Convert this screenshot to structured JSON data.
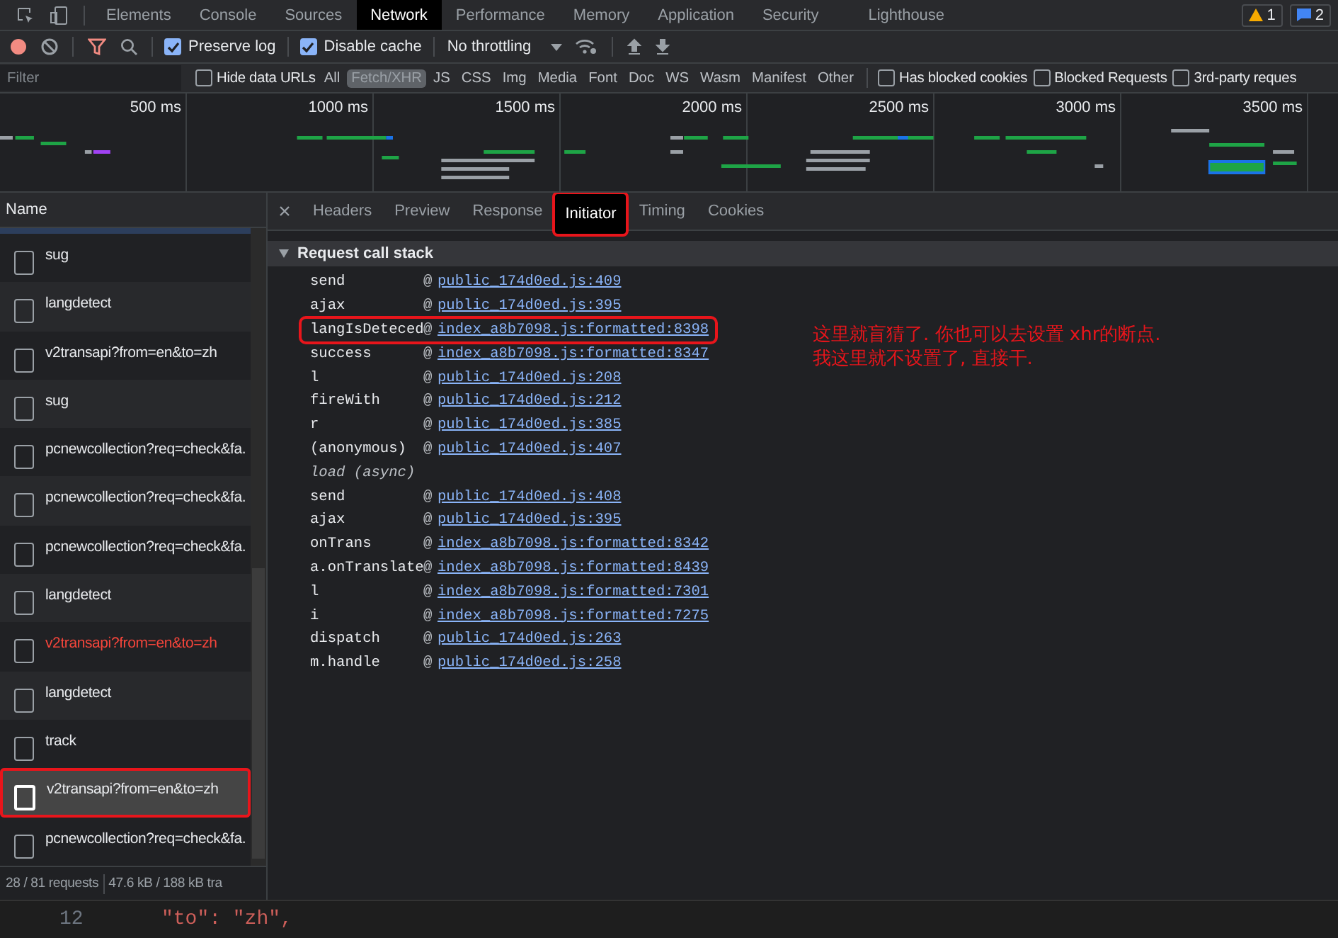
{
  "devtools_tabs": [
    {
      "label": "Elements",
      "selected": false
    },
    {
      "label": "Console",
      "selected": false
    },
    {
      "label": "Sources",
      "selected": false
    },
    {
      "label": "Network",
      "selected": true
    },
    {
      "label": "Performance",
      "selected": false
    },
    {
      "label": "Memory",
      "selected": false
    },
    {
      "label": "Application",
      "selected": false
    },
    {
      "label": "Security",
      "selected": false
    },
    {
      "label": "Lighthouse",
      "selected": false
    }
  ],
  "badges": [
    {
      "kind": "warning",
      "count": "1"
    },
    {
      "kind": "message",
      "count": "2"
    }
  ],
  "toolbar": {
    "recording": true,
    "preserve_log": {
      "label": "Preserve log",
      "checked": true
    },
    "disable_cache": {
      "label": "Disable cache",
      "checked": true
    },
    "throttling": "No throttling"
  },
  "filter": {
    "placeholder": "Filter",
    "hide_data_urls": {
      "label": "Hide data URLs",
      "checked": false
    },
    "types": [
      {
        "label": "All",
        "selected": false
      },
      {
        "label": "Fetch/XHR",
        "selected": true
      },
      {
        "label": "JS",
        "selected": false
      },
      {
        "label": "CSS",
        "selected": false
      },
      {
        "label": "Img",
        "selected": false
      },
      {
        "label": "Media",
        "selected": false
      },
      {
        "label": "Font",
        "selected": false
      },
      {
        "label": "Doc",
        "selected": false
      },
      {
        "label": "WS",
        "selected": false
      },
      {
        "label": "Wasm",
        "selected": false
      },
      {
        "label": "Manifest",
        "selected": false
      },
      {
        "label": "Other",
        "selected": false
      }
    ],
    "options": [
      {
        "label": "Has blocked cookies",
        "checked": false
      },
      {
        "label": "Blocked Requests",
        "checked": false
      },
      {
        "label": "3rd-party reques",
        "checked": false
      }
    ]
  },
  "overview": {
    "ticks": [
      "500 ms",
      "1000 ms",
      "1500 ms",
      "2000 ms",
      "2500 ms",
      "3000 ms",
      "3500 ms"
    ]
  },
  "requests": {
    "column": "Name",
    "rows": [
      {
        "name": "sug",
        "failed": false,
        "selected": false,
        "highlighted": false
      },
      {
        "name": "langdetect",
        "failed": false,
        "selected": false,
        "highlighted": false
      },
      {
        "name": "v2transapi?from=en&to=zh",
        "failed": false,
        "selected": false,
        "highlighted": false
      },
      {
        "name": "sug",
        "failed": false,
        "selected": false,
        "highlighted": false
      },
      {
        "name": "pcnewcollection?req=check&fa.",
        "failed": false,
        "selected": false,
        "highlighted": false
      },
      {
        "name": "pcnewcollection?req=check&fa.",
        "failed": false,
        "selected": false,
        "highlighted": false
      },
      {
        "name": "pcnewcollection?req=check&fa.",
        "failed": false,
        "selected": false,
        "highlighted": false
      },
      {
        "name": "langdetect",
        "failed": false,
        "selected": false,
        "highlighted": false
      },
      {
        "name": "v2transapi?from=en&to=zh",
        "failed": true,
        "selected": false,
        "highlighted": false
      },
      {
        "name": "langdetect",
        "failed": false,
        "selected": false,
        "highlighted": false
      },
      {
        "name": "track",
        "failed": false,
        "selected": false,
        "highlighted": false
      },
      {
        "name": "v2transapi?from=en&to=zh",
        "failed": false,
        "selected": true,
        "highlighted": true
      },
      {
        "name": "pcnewcollection?req=check&fa.",
        "failed": false,
        "selected": false,
        "highlighted": false
      }
    ],
    "summary": [
      "28 / 81 requests",
      "47.6 kB / 188 kB tra"
    ]
  },
  "detail_tabs": [
    {
      "label": "Headers",
      "selected": false,
      "highlighted": false
    },
    {
      "label": "Preview",
      "selected": false,
      "highlighted": false
    },
    {
      "label": "Response",
      "selected": false,
      "highlighted": false
    },
    {
      "label": "Initiator",
      "selected": true,
      "highlighted": true
    },
    {
      "label": "Timing",
      "selected": false,
      "highlighted": false
    },
    {
      "label": "Cookies",
      "selected": false,
      "highlighted": false
    }
  ],
  "call_stack": {
    "title": "Request call stack",
    "expanded": true,
    "frames": [
      {
        "kind": "frame",
        "function": "send",
        "location": "public_174d0ed.js:409",
        "highlighted": false
      },
      {
        "kind": "frame",
        "function": "ajax",
        "location": "public_174d0ed.js:395",
        "highlighted": false
      },
      {
        "kind": "frame",
        "function": "langIsDeteced",
        "location": "index_a8b7098.js:formatted:8398",
        "highlighted": true
      },
      {
        "kind": "frame",
        "function": "success",
        "location": "index_a8b7098.js:formatted:8347",
        "highlighted": false
      },
      {
        "kind": "frame",
        "function": "l",
        "location": "public_174d0ed.js:208",
        "highlighted": false
      },
      {
        "kind": "frame",
        "function": "fireWith",
        "location": "public_174d0ed.js:212",
        "highlighted": false
      },
      {
        "kind": "frame",
        "function": "r",
        "location": "public_174d0ed.js:385",
        "highlighted": false
      },
      {
        "kind": "frame",
        "function": "(anonymous)",
        "location": "public_174d0ed.js:407",
        "highlighted": false
      },
      {
        "kind": "async",
        "function": "load (async)"
      },
      {
        "kind": "frame",
        "function": "send",
        "location": "public_174d0ed.js:408",
        "highlighted": false
      },
      {
        "kind": "frame",
        "function": "ajax",
        "location": "public_174d0ed.js:395",
        "highlighted": false
      },
      {
        "kind": "frame",
        "function": "onTrans",
        "location": "index_a8b7098.js:formatted:8342",
        "highlighted": false
      },
      {
        "kind": "frame",
        "function": "a.onTranslate",
        "location": "index_a8b7098.js:formatted:8439",
        "highlighted": false
      },
      {
        "kind": "frame",
        "function": "l",
        "location": "index_a8b7098.js:formatted:7301",
        "highlighted": false
      },
      {
        "kind": "frame",
        "function": "i",
        "location": "index_a8b7098.js:formatted:7275",
        "highlighted": false
      },
      {
        "kind": "frame",
        "function": "dispatch",
        "location": "public_174d0ed.js:263",
        "highlighted": false
      },
      {
        "kind": "frame",
        "function": "m.handle",
        "location": "public_174d0ed.js:258",
        "highlighted": false
      }
    ]
  },
  "call_stack_at": "@",
  "annotation": [
    "这里就盲猜了. 你也可以去设置 xhr的断点.",
    "我这里就不设置了, 直接干."
  ],
  "editor": {
    "line_number": "12",
    "code": "\"to\": \"zh\","
  }
}
